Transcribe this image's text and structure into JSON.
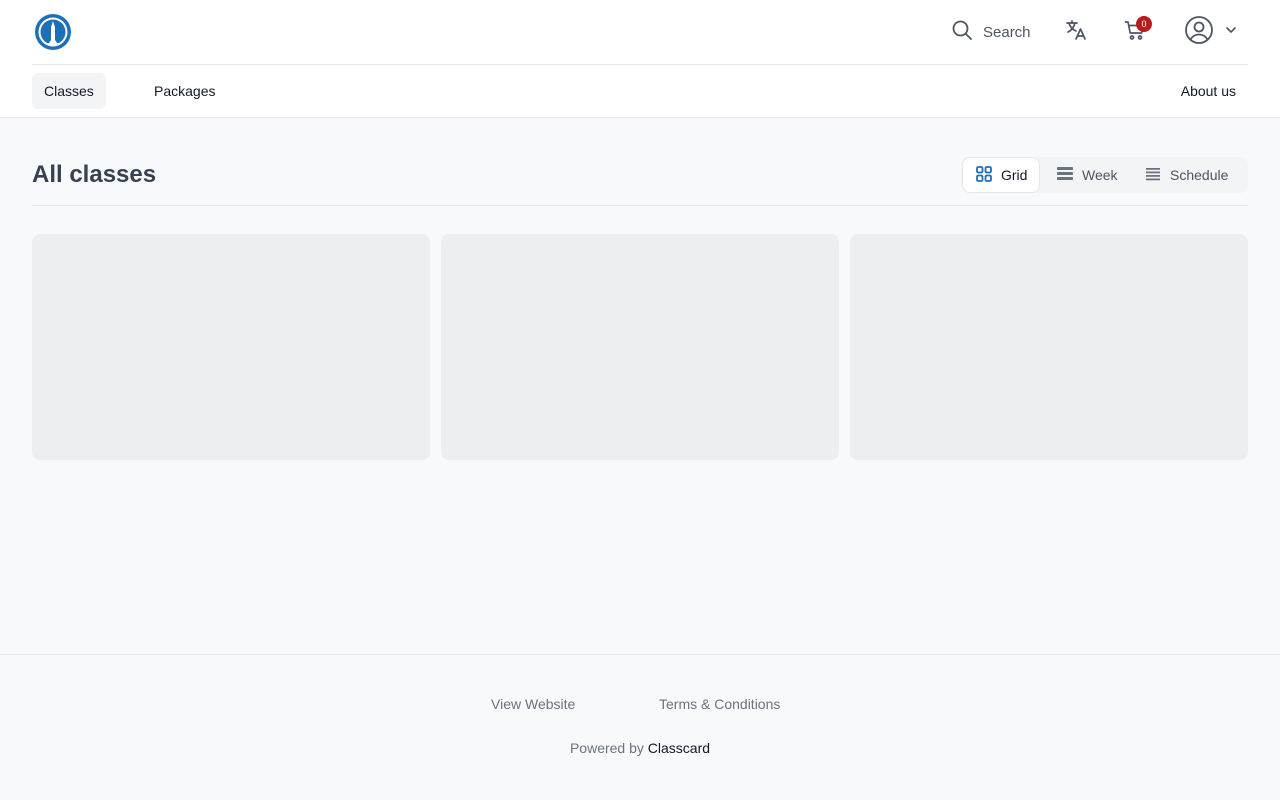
{
  "header": {
    "search_label": "Search",
    "cart_count": "0"
  },
  "nav": {
    "classes": "Classes",
    "packages": "Packages",
    "about": "About us"
  },
  "main": {
    "title": "All classes",
    "views": {
      "grid": "Grid",
      "week": "Week",
      "schedule": "Schedule"
    },
    "active_view": "Grid"
  },
  "footer": {
    "view_website": "View Website",
    "terms": "Terms & Conditions",
    "powered_prefix": "Powered by",
    "powered_brand": "Classcard"
  },
  "colors": {
    "accent": "#1d6fb8",
    "badge": "#b91c1c",
    "skeleton": "#edeef0"
  }
}
